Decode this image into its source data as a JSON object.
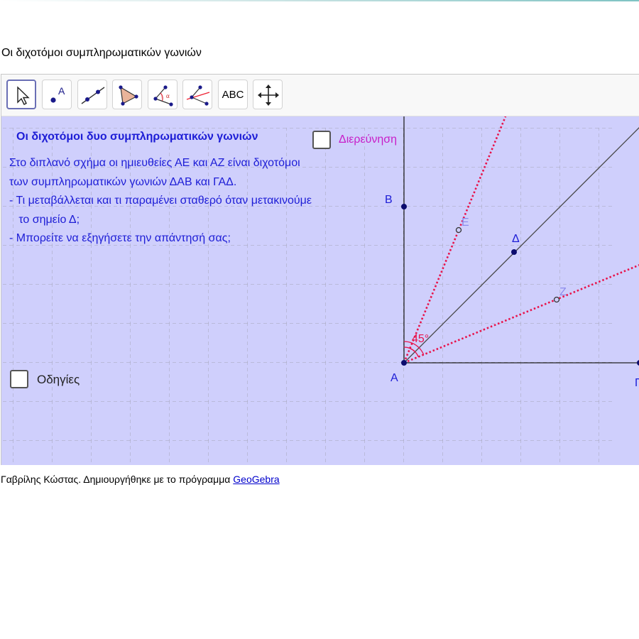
{
  "page": {
    "title": "Οι διχοτόμοι συμπληρωματικών γωνιών",
    "footer_text": "Γαβρίλης Κώστας. Δημιουργήθηκε με το πρόγραμμα ",
    "footer_link": "GeoGebra"
  },
  "toolbar": {
    "tools": [
      {
        "name": "move-tool",
        "icon": "arrow-icon",
        "active": true
      },
      {
        "name": "point-tool",
        "icon": "point-icon",
        "text": "A"
      },
      {
        "name": "line-tool",
        "icon": "line-icon"
      },
      {
        "name": "polygon-tool",
        "icon": "polygon-icon"
      },
      {
        "name": "angle-tool",
        "icon": "angle-icon",
        "text": "α"
      },
      {
        "name": "perpendicular-tool",
        "icon": "perpendicular-line-icon"
      },
      {
        "name": "text-tool",
        "icon": "text-icon",
        "text": "ABC"
      },
      {
        "name": "move-graphics-tool",
        "icon": "move-cross-icon"
      }
    ]
  },
  "canvas": {
    "heading": "Οι διχοτόμοι δυο συμπληρωματικών γωνιών",
    "description_lines": [
      "Στο διπλανό σχήμα οι ημιευθείες ΑΕ και ΑΖ είναι διχοτόμοι",
      "των συμπληρωματικών γωνιών ΔΑΒ και ΓΑΔ.",
      "- Τι μεταβάλλεται και τι παραμένει σταθερό όταν μετακινούμε",
      "   το σημείο Δ;",
      "- Μπορείτε να εξηγήσετε την απάντησή σας;"
    ],
    "checkbox_explore": {
      "label": "Διερεύνηση",
      "checked": false
    },
    "checkbox_instructions": {
      "label": "Οδηγίες",
      "checked": false
    },
    "points": {
      "A": "Α",
      "B": "Β",
      "D": "Δ",
      "E": "Ε",
      "Z": "Ζ",
      "G": "Γ"
    },
    "angle_label": "45°"
  },
  "colors": {
    "canvas_bg": "#cfcffc",
    "text_blue": "#1d1dd6",
    "bisector_red": "#e8124a",
    "explore_magenta": "#c81ec8",
    "point_navy": "#0b0b6e"
  }
}
